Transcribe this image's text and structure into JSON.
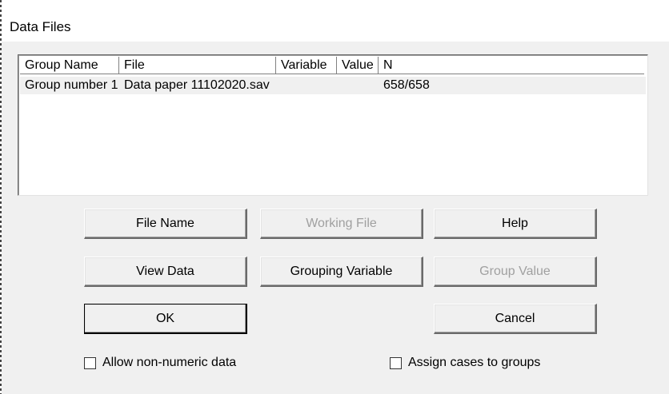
{
  "window": {
    "title": "Data Files"
  },
  "list": {
    "columns": [
      "Group Name",
      "File",
      "Variable",
      "Value",
      "N"
    ],
    "rows": [
      [
        "Group number 1",
        "Data paper 11102020.sav",
        "",
        "",
        "658/658"
      ]
    ]
  },
  "buttons": {
    "file_name": "File Name",
    "working_file": "Working File",
    "help": "Help",
    "view_data": "View Data",
    "grouping_variable": "Grouping Variable",
    "group_value": "Group Value",
    "ok": "OK",
    "cancel": "Cancel"
  },
  "checkboxes": {
    "allow_non_numeric": {
      "label": "Allow non-numeric data",
      "checked": false
    },
    "assign_cases": {
      "label": "Assign cases to groups",
      "checked": false
    }
  }
}
